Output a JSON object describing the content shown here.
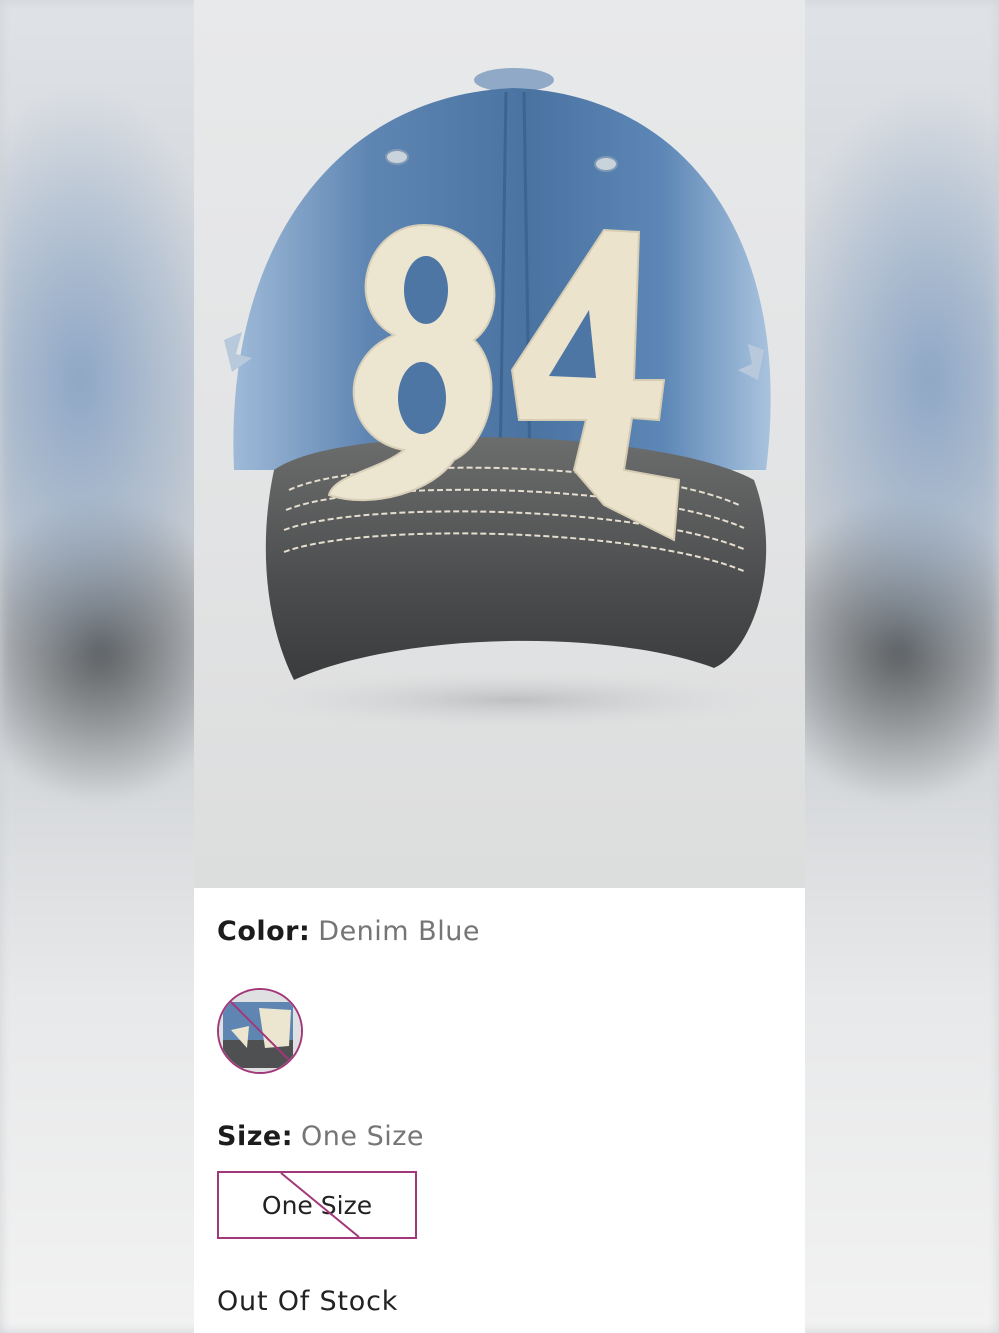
{
  "product": {
    "image_name": "denim-84-patch-cap"
  },
  "color": {
    "label": "Color:",
    "value": "Denim Blue",
    "selected_swatch": "Denim Blue",
    "swatch_unavailable": true
  },
  "size": {
    "label": "Size:",
    "value": "One Size",
    "options": [
      "One Size"
    ],
    "option_unavailable": true
  },
  "stock": {
    "status": "Out Of Stock"
  },
  "colors": {
    "accent": "#a2387a",
    "text": "#222222",
    "muted": "#757575",
    "denim": "#4f78a6",
    "brim": "#505152",
    "patch": "#ede6d2"
  }
}
